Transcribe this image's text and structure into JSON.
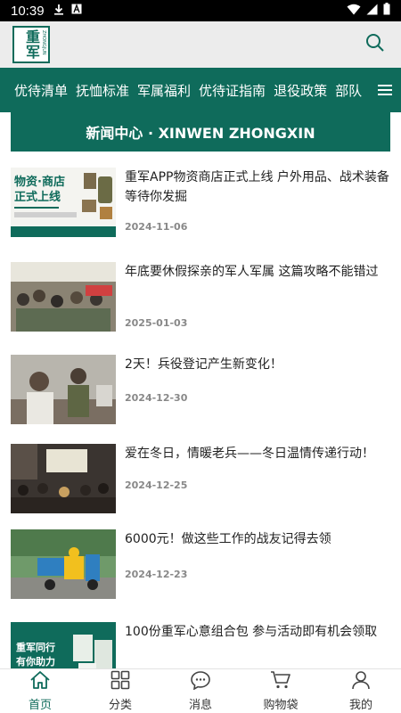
{
  "status_bar": {
    "time": "10:39"
  },
  "header": {
    "logo_text": "重军",
    "logo_side_text": "ZHONGJUN",
    "search_icon": "search-icon"
  },
  "nav": {
    "items": [
      "优待清单",
      "抚恤标准",
      "军属福利",
      "优待证指南",
      "退役政策",
      "部队"
    ],
    "menu_icon": "hamburger-menu-icon"
  },
  "section_title": "新闻中心 · XINWEN ZHONGXIN",
  "news": [
    {
      "title": "重军APP物资商店正式上线 户外用品、战术装备等待你发掘",
      "date": "2024-11-06",
      "thumb_text": "物资·商店\n正式上线"
    },
    {
      "title": "年底要休假探亲的军人军属 这篇攻略不能错过",
      "date": "2025-01-03"
    },
    {
      "title": "2天！兵役登记产生新变化！",
      "date": "2024-12-30"
    },
    {
      "title": "爱在冬日，情暖老兵——冬日温情传递行动！",
      "date": "2024-12-25"
    },
    {
      "title": "6000元！做这些工作的战友记得去领",
      "date": "2024-12-23"
    },
    {
      "title": "100份重军心意组合包 参与活动即有机会领取",
      "date": "",
      "thumb_text": "重军同行\n有你助力"
    }
  ],
  "tabs": [
    {
      "label": "首页",
      "icon": "home-icon",
      "active": true
    },
    {
      "label": "分类",
      "icon": "grid-icon",
      "active": false
    },
    {
      "label": "消息",
      "icon": "chat-bubble-icon",
      "active": false
    },
    {
      "label": "购物袋",
      "icon": "cart-icon",
      "active": false
    },
    {
      "label": "我的",
      "icon": "user-icon",
      "active": false
    }
  ],
  "colors": {
    "brand": "#0f6b5b",
    "tab_active": "#0f6b5b"
  }
}
